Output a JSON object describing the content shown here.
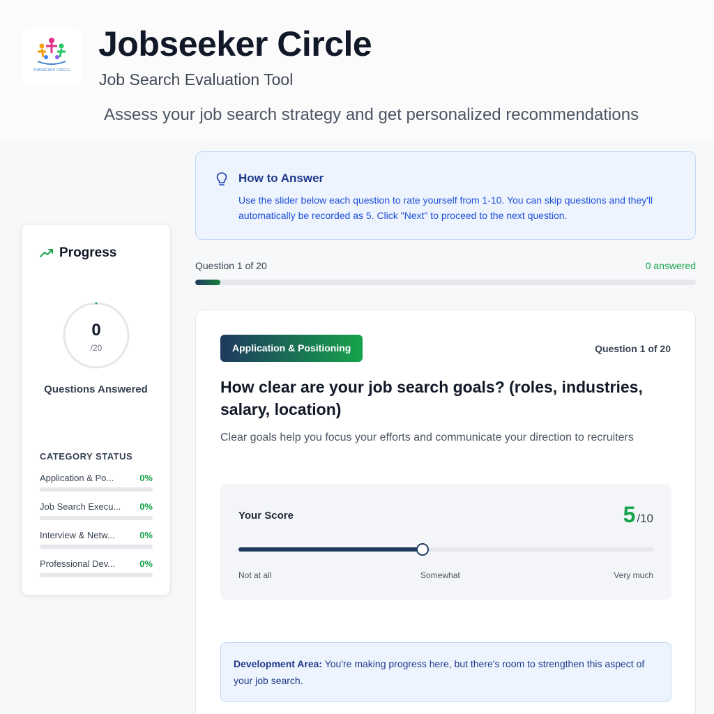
{
  "header": {
    "logo_text": "JOBSEEKER CIRCLE",
    "title": "Jobseeker Circle",
    "subtitle": "Job Search Evaluation Tool",
    "tagline": "Assess your job search strategy and get personalized recommendations"
  },
  "sidebar": {
    "progress_title": "Progress",
    "answered_count": "0",
    "answered_total": "/20",
    "answered_label": "Questions Answered",
    "category_status_title": "CATEGORY STATUS",
    "categories": [
      {
        "name": "Application & Po...",
        "percent": "0%",
        "fraction": 0
      },
      {
        "name": "Job Search Execu...",
        "percent": "0%",
        "fraction": 0
      },
      {
        "name": "Interview & Netw...",
        "percent": "0%",
        "fraction": 0
      },
      {
        "name": "Professional Dev...",
        "percent": "0%",
        "fraction": 0
      }
    ]
  },
  "howto": {
    "icon": "lightbulb-icon",
    "title": "How to Answer",
    "body": "Use the slider below each question to rate yourself from 1-10. You can skip questions and they'll automatically be recorded as 5. Click \"Next\" to proceed to the next question."
  },
  "progress": {
    "question_counter": "Question 1 of 20",
    "answered": "0 answered",
    "fraction": 0.05
  },
  "question": {
    "category": "Application & Positioning",
    "counter": "Question 1 of 20",
    "text": "How clear are your job search goals? (roles, industries, salary, location)",
    "help": "Clear goals help you focus your efforts and communicate your direction to recruiters"
  },
  "score": {
    "label": "Your Score",
    "value": "5",
    "max": "/10",
    "numeric": 5,
    "min_value": 1,
    "max_value": 10,
    "min_label": "Not at all",
    "mid_label": "Somewhat",
    "max_label": "Very much"
  },
  "feedback": {
    "strong": "Development Area:",
    "text": " You're making progress here, but there's room to strengthen this aspect of your job search."
  },
  "colors": {
    "accent_green": "#16a34a",
    "navy": "#1e3a5f",
    "info_blue": "#1e3a8a"
  }
}
